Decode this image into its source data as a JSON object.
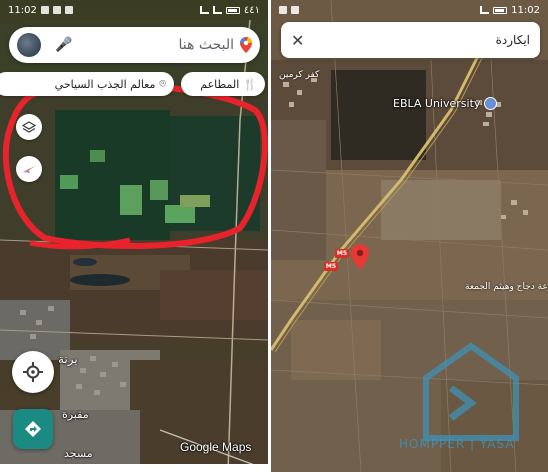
{
  "left_screen": {
    "status_bar": {
      "time": "11:02",
      "network": "٤٤١"
    },
    "search": {
      "placeholder": "البحث هنا"
    },
    "chips": [
      {
        "label": "المطاعم",
        "icon": "fork-knife-icon"
      },
      {
        "label": "معالم الجذب السياحي",
        "icon": "camera-icon"
      }
    ],
    "map_labels": {
      "town": "برنة",
      "cemetery": "مقبرة",
      "mosque": "مسجد"
    },
    "attribution": "Google Maps",
    "annotation_color": "#e8232b"
  },
  "right_screen": {
    "status_bar": {
      "time": "11:02"
    },
    "search": {
      "query": "ايكاردة"
    },
    "map_labels": {
      "university": "EBLA University",
      "village": "مزرعة دجاج وهيثم الجمعة",
      "top": "كفر كرمين"
    },
    "road_shields": [
      "M5",
      "M5"
    ],
    "watermark": "HOMPPER | YASA"
  },
  "colors": {
    "accent_teal": "#1a8a83",
    "pin_red": "#e53935",
    "road_shield": "#d93025"
  }
}
